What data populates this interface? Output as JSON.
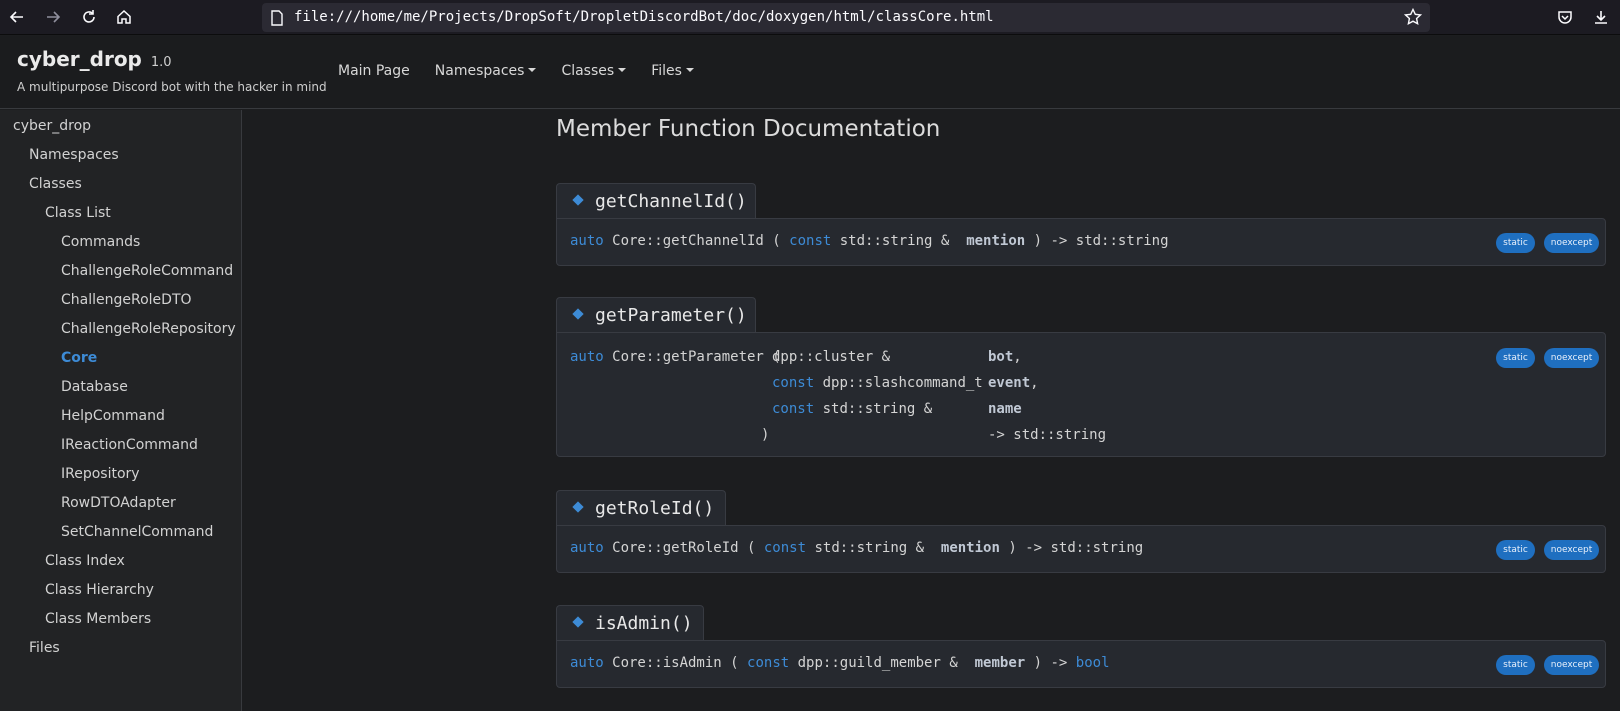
{
  "browser": {
    "url": "file:///home/me/Projects/DropSoft/DropletDiscordBot/doc/doxygen/html/classCore.html",
    "icons": [
      "back-icon",
      "forward-icon",
      "reload-icon",
      "home-icon",
      "page-icon",
      "bookmark-star-icon",
      "pocket-icon",
      "downloads-icon"
    ]
  },
  "header": {
    "project_name": "cyber_drop",
    "project_number": "1.0",
    "project_brief": "A multipurpose Discord bot with the hacker in mind",
    "menu": [
      {
        "label": "Main Page"
      },
      {
        "label": "Namespaces"
      },
      {
        "label": "Classes"
      },
      {
        "label": "Files"
      }
    ]
  },
  "sidebar": {
    "items": [
      {
        "label": "cyber_drop"
      },
      {
        "label": "Namespaces"
      },
      {
        "label": "Classes"
      },
      {
        "label": "Class List"
      },
      {
        "label": "Commands"
      },
      {
        "label": "ChallengeRoleCommand"
      },
      {
        "label": "ChallengeRoleDTO"
      },
      {
        "label": "ChallengeRoleRepository"
      },
      {
        "label": "Core"
      },
      {
        "label": "Database"
      },
      {
        "label": "HelpCommand"
      },
      {
        "label": "IReactionCommand"
      },
      {
        "label": "IRepository"
      },
      {
        "label": "RowDTOAdapter"
      },
      {
        "label": "SetChannelCommand"
      },
      {
        "label": "Class Index"
      },
      {
        "label": "Class Hierarchy"
      },
      {
        "label": "Class Members"
      },
      {
        "label": "Files"
      }
    ]
  },
  "main": {
    "section_title": "Member Function Documentation",
    "badges": {
      "static": "static",
      "noexcept": "noexcept"
    },
    "members": [
      {
        "title": "getChannelId()",
        "lines": [
          {
            "pre": "auto",
            "name": " Core::getChannelId",
            "open": " ( ",
            "kw": "const",
            "type": " std::string & ",
            "param": " mention",
            "post": " ) -> std::string"
          }
        ]
      },
      {
        "title": "getParameter()",
        "sig_auto": "auto",
        "sig_name": " Core::getParameter",
        "sig_open": " (",
        "sig_close": ")",
        "params": [
          {
            "kw": "",
            "type": "dpp::cluster &",
            "name": "bot",
            "sep": ","
          },
          {
            "kw": "const",
            "type": " dpp::slashcommand_t",
            "name": "event",
            "sep": ","
          },
          {
            "kw": "const",
            "type": " std::string &",
            "name": "name",
            "sep": ""
          }
        ],
        "return": "-> std::string"
      },
      {
        "title": "getRoleId()",
        "lines": [
          {
            "pre": "auto",
            "name": " Core::getRoleId",
            "open": " ( ",
            "kw": "const",
            "type": " std::string & ",
            "param": " mention",
            "post": " ) -> std::string"
          }
        ]
      },
      {
        "title": "isAdmin()",
        "lines": [
          {
            "pre": "auto",
            "name": " Core::isAdmin",
            "open": " ( ",
            "kw": "const",
            "type": " dpp::guild_member & ",
            "param": " member",
            "post": " ) -> ",
            "ret_kw": "bool"
          }
        ]
      }
    ]
  }
}
